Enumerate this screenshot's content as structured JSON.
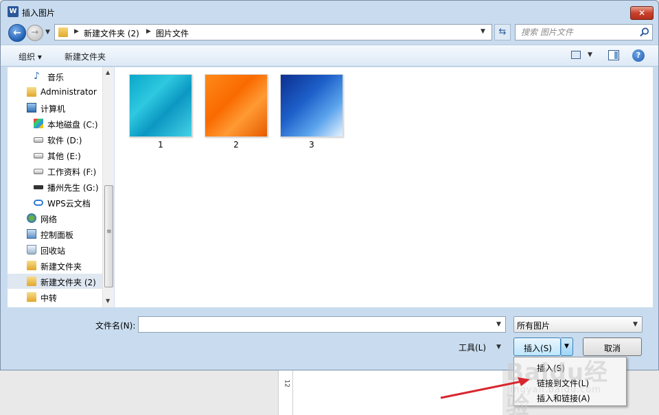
{
  "window": {
    "title": "插入图片",
    "app_icon": "word-icon",
    "close_glyph": "✕"
  },
  "nav": {
    "back_glyph": "←",
    "forward_glyph": "→",
    "breadcrumb": [
      "新建文件夹 (2)",
      "图片文件"
    ],
    "refresh_glyph": "⇆",
    "search_placeholder": "搜索 图片文件"
  },
  "toolbar": {
    "organize": "组织 ▾",
    "new_folder": "新建文件夹",
    "help": "?"
  },
  "sidebar": {
    "items": [
      {
        "label": "音乐",
        "icon": "music-icon"
      },
      {
        "label": "Administrator",
        "icon": "user-folder-icon"
      },
      {
        "label": "计算机",
        "icon": "computer-icon"
      },
      {
        "label": "本地磁盘 (C:)",
        "icon": "system-drive-icon"
      },
      {
        "label": "软件 (D:)",
        "icon": "drive-icon"
      },
      {
        "label": "其他 (E:)",
        "icon": "drive-icon"
      },
      {
        "label": "工作资料 (F:)",
        "icon": "drive-icon"
      },
      {
        "label": "播州先生 (G:)",
        "icon": "usb-drive-icon"
      },
      {
        "label": "WPS云文档",
        "icon": "cloud-icon"
      },
      {
        "label": "网络",
        "icon": "network-icon"
      },
      {
        "label": "控制面板",
        "icon": "control-panel-icon"
      },
      {
        "label": "回收站",
        "icon": "recycle-bin-icon"
      },
      {
        "label": "新建文件夹",
        "icon": "folder-icon"
      },
      {
        "label": "新建文件夹 (2)",
        "icon": "folder-icon",
        "selected": true
      },
      {
        "label": "中转",
        "icon": "folder-icon"
      }
    ]
  },
  "files": [
    {
      "name": "1",
      "color": "#1fb8d6"
    },
    {
      "name": "2",
      "color": "#f97a0a"
    },
    {
      "name": "3",
      "color": "#1d5fc9"
    }
  ],
  "bottom": {
    "filename_label": "文件名(N):",
    "filename_value": "",
    "filter_value": "所有图片",
    "tools_label": "工具(L)",
    "insert_label": "插入(S)",
    "cancel_label": "取消"
  },
  "insert_menu": {
    "items": [
      "插入(S)",
      "链接到文件(L)",
      "插入和链接(A)"
    ]
  },
  "background": {
    "ruler_text": "12"
  },
  "watermark": {
    "big": "Baidu经验",
    "small": "jingyan.baidu.com"
  },
  "colors": {
    "titlebar": "#c9dcef",
    "accent": "#3c7fb1",
    "annotation_arrow": "#d9262e"
  }
}
